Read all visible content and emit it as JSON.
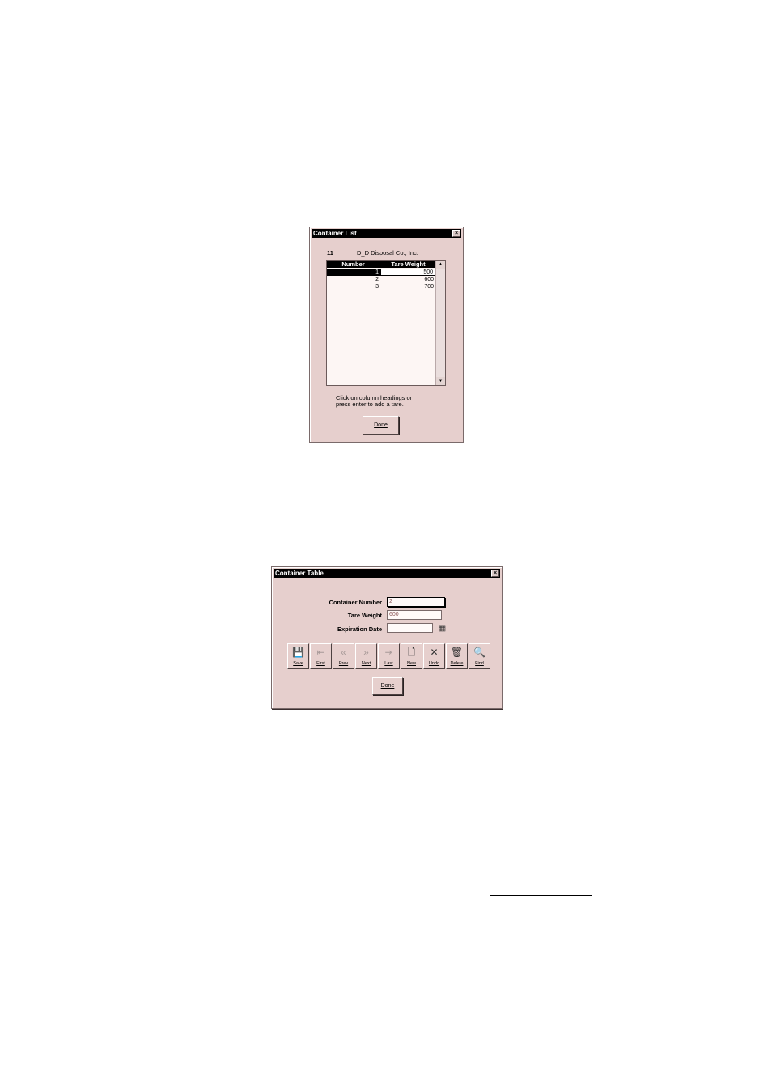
{
  "container_list": {
    "title": "Container List",
    "company_code": "11",
    "company_name": "D_D Disposal Co., Inc.",
    "columns": [
      "Number",
      "Tare Weight"
    ],
    "rows": [
      {
        "number": "1",
        "tare_weight": "500",
        "selected": true
      },
      {
        "number": "2",
        "tare_weight": "600"
      },
      {
        "number": "3",
        "tare_weight": "700"
      }
    ],
    "hint_line1": "Click on column headings or",
    "hint_line2": "press enter to add a tare.",
    "done_label": "Done",
    "close_glyph": "×"
  },
  "container_table": {
    "title": "Container Table",
    "fields": {
      "container_number_label": "Container Number",
      "container_number_value": "2",
      "tare_weight_label": "Tare Weight",
      "tare_weight_value": "600",
      "expiration_date_label": "Expiration Date",
      "expiration_date_value": ""
    },
    "toolbar": [
      {
        "label": "Save",
        "icon": "save-icon",
        "glyph": "💾",
        "enabled": true
      },
      {
        "label": "First",
        "icon": "first-icon",
        "glyph": "⇤",
        "enabled": false
      },
      {
        "label": "Prev",
        "icon": "prev-icon",
        "glyph": "«",
        "enabled": false
      },
      {
        "label": "Next",
        "icon": "next-icon",
        "glyph": "»",
        "enabled": false
      },
      {
        "label": "Last",
        "icon": "last-icon",
        "glyph": "⇥",
        "enabled": false
      },
      {
        "label": "New",
        "icon": "new-icon",
        "glyph": "🗋",
        "enabled": true
      },
      {
        "label": "Undo",
        "icon": "undo-icon",
        "glyph": "✕",
        "enabled": true
      },
      {
        "label": "Delete",
        "icon": "delete-icon",
        "glyph": "🗑",
        "enabled": true
      },
      {
        "label": "Find",
        "icon": "find-icon",
        "glyph": "🔍",
        "enabled": true
      }
    ],
    "done_label": "Done",
    "close_glyph": "×",
    "calendar_glyph": "▦"
  }
}
